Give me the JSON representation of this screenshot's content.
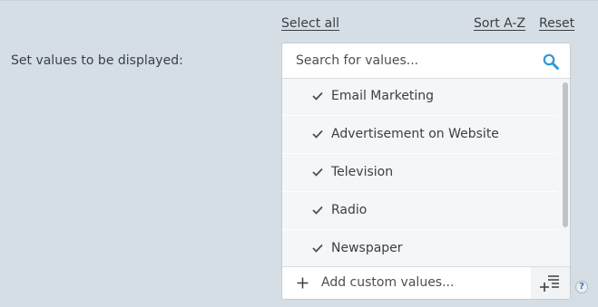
{
  "toolbar": {
    "select_all": "Select all",
    "sort": "Sort A-Z",
    "reset": "Reset"
  },
  "field": {
    "label": "Set values to be displayed:"
  },
  "search": {
    "placeholder": "Search for values...",
    "icon": "search-icon"
  },
  "values": [
    {
      "label": "Email Marketing",
      "checked": true
    },
    {
      "label": "Advertisement on Website",
      "checked": true
    },
    {
      "label": "Television",
      "checked": true
    },
    {
      "label": "Radio",
      "checked": true
    },
    {
      "label": "Newspaper",
      "checked": true
    }
  ],
  "add_custom": {
    "label": "Add custom values..."
  },
  "help": {
    "glyph": "?"
  },
  "colors": {
    "background": "#d5dee5",
    "search_icon": "#2a9ad8",
    "help_icon": "#3f76ad"
  }
}
